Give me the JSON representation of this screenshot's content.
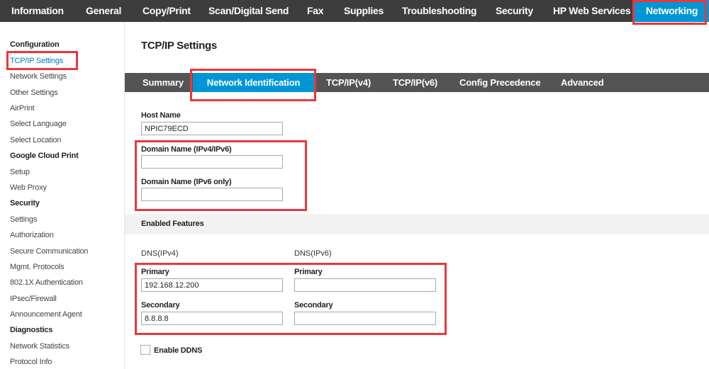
{
  "topnav": {
    "tabs": [
      {
        "label": "Information"
      },
      {
        "label": "General"
      },
      {
        "label": "Copy/Print"
      },
      {
        "label": "Scan/Digital Send"
      },
      {
        "label": "Fax"
      },
      {
        "label": "Supplies"
      },
      {
        "label": "Troubleshooting"
      },
      {
        "label": "Security"
      },
      {
        "label": "HP Web Services"
      },
      {
        "label": "Networking"
      }
    ],
    "active_color": "#0096d6"
  },
  "sidebar": {
    "items": [
      {
        "label": "Configuration"
      },
      {
        "label": "TCP/IP Settings"
      },
      {
        "label": "Network Settings"
      },
      {
        "label": "Other Settings"
      },
      {
        "label": "AirPrint"
      },
      {
        "label": "Select Language"
      },
      {
        "label": "Select Location"
      },
      {
        "label": "Google Cloud Print"
      },
      {
        "label": "Setup"
      },
      {
        "label": "Web Proxy"
      },
      {
        "label": "Security"
      },
      {
        "label": "Settings"
      },
      {
        "label": "Authorization"
      },
      {
        "label": "Secure Communication"
      },
      {
        "label": "Mgmt. Protocols"
      },
      {
        "label": "802.1X Authentication"
      },
      {
        "label": "IPsec/Firewall"
      },
      {
        "label": "Announcement Agent"
      },
      {
        "label": "Diagnostics"
      },
      {
        "label": "Network Statistics"
      },
      {
        "label": "Protocol Info"
      }
    ]
  },
  "main": {
    "title": "TCP/IP Settings",
    "subtabs": [
      {
        "label": "Summary"
      },
      {
        "label": "Network Identification"
      },
      {
        "label": "TCP/IP(v4)"
      },
      {
        "label": "TCP/IP(v6)"
      },
      {
        "label": "Config Precedence"
      },
      {
        "label": "Advanced"
      }
    ],
    "host_name": {
      "label": "Host Name",
      "value": "NPIC79ECD"
    },
    "domain_v4v6": {
      "label": "Domain Name (IPv4/IPv6)",
      "value": ""
    },
    "domain_v6": {
      "label": "Domain Name (IPv6 only)",
      "value": ""
    },
    "enabled_features": "Enabled Features",
    "dns_v4": {
      "heading": "DNS(IPv4)",
      "primary_label": "Primary",
      "primary_value": "192.168.12.200",
      "secondary_label": "Secondary",
      "secondary_value": "8.8.8.8"
    },
    "dns_v6": {
      "heading": "DNS(IPv6)",
      "primary_label": "Primary",
      "primary_value": "",
      "secondary_label": "Secondary",
      "secondary_value": ""
    },
    "enable_ddns": {
      "label": "Enable DDNS",
      "checked": false
    }
  },
  "highlight_color": "#e8383d"
}
